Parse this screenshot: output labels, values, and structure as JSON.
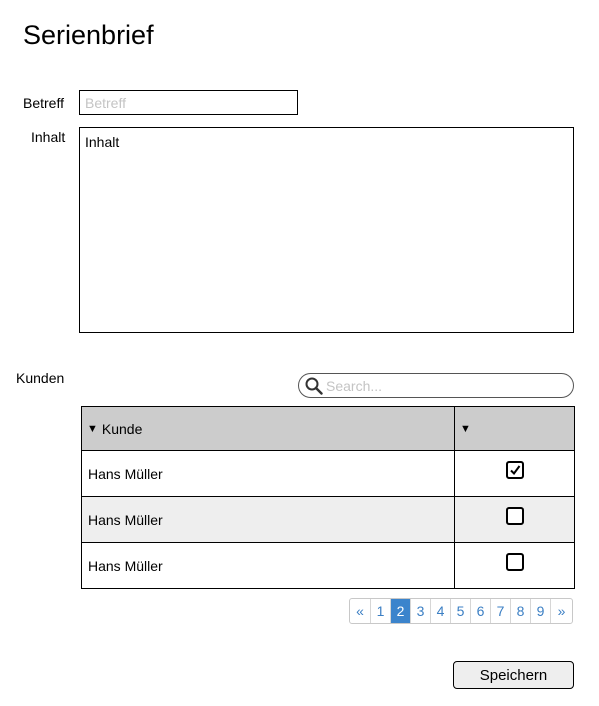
{
  "page": {
    "title": "Serienbrief"
  },
  "form": {
    "subject_label": "Betreff",
    "subject_placeholder": "Betreff",
    "content_label": "Inhalt",
    "content_value": "Inhalt",
    "customers_label": "Kunden"
  },
  "search": {
    "placeholder": "Search...",
    "icon": "search-icon"
  },
  "table": {
    "columns": [
      {
        "label": "Kunde",
        "sort_icon": "▼"
      },
      {
        "label": "",
        "sort_icon": "▼"
      }
    ],
    "rows": [
      {
        "name": "Hans Müller",
        "selected": true
      },
      {
        "name": "Hans Müller",
        "selected": false
      },
      {
        "name": "Hans Müller",
        "selected": false
      }
    ]
  },
  "pagination": {
    "prev": "«",
    "next": "»",
    "pages": [
      "1",
      "2",
      "3",
      "4",
      "5",
      "6",
      "7",
      "8",
      "9"
    ],
    "current": "2"
  },
  "actions": {
    "save_label": "Speichern"
  },
  "colors": {
    "header_bg": "#cccccc",
    "active_page": "#3b84cc",
    "link": "#3b7fc4"
  }
}
